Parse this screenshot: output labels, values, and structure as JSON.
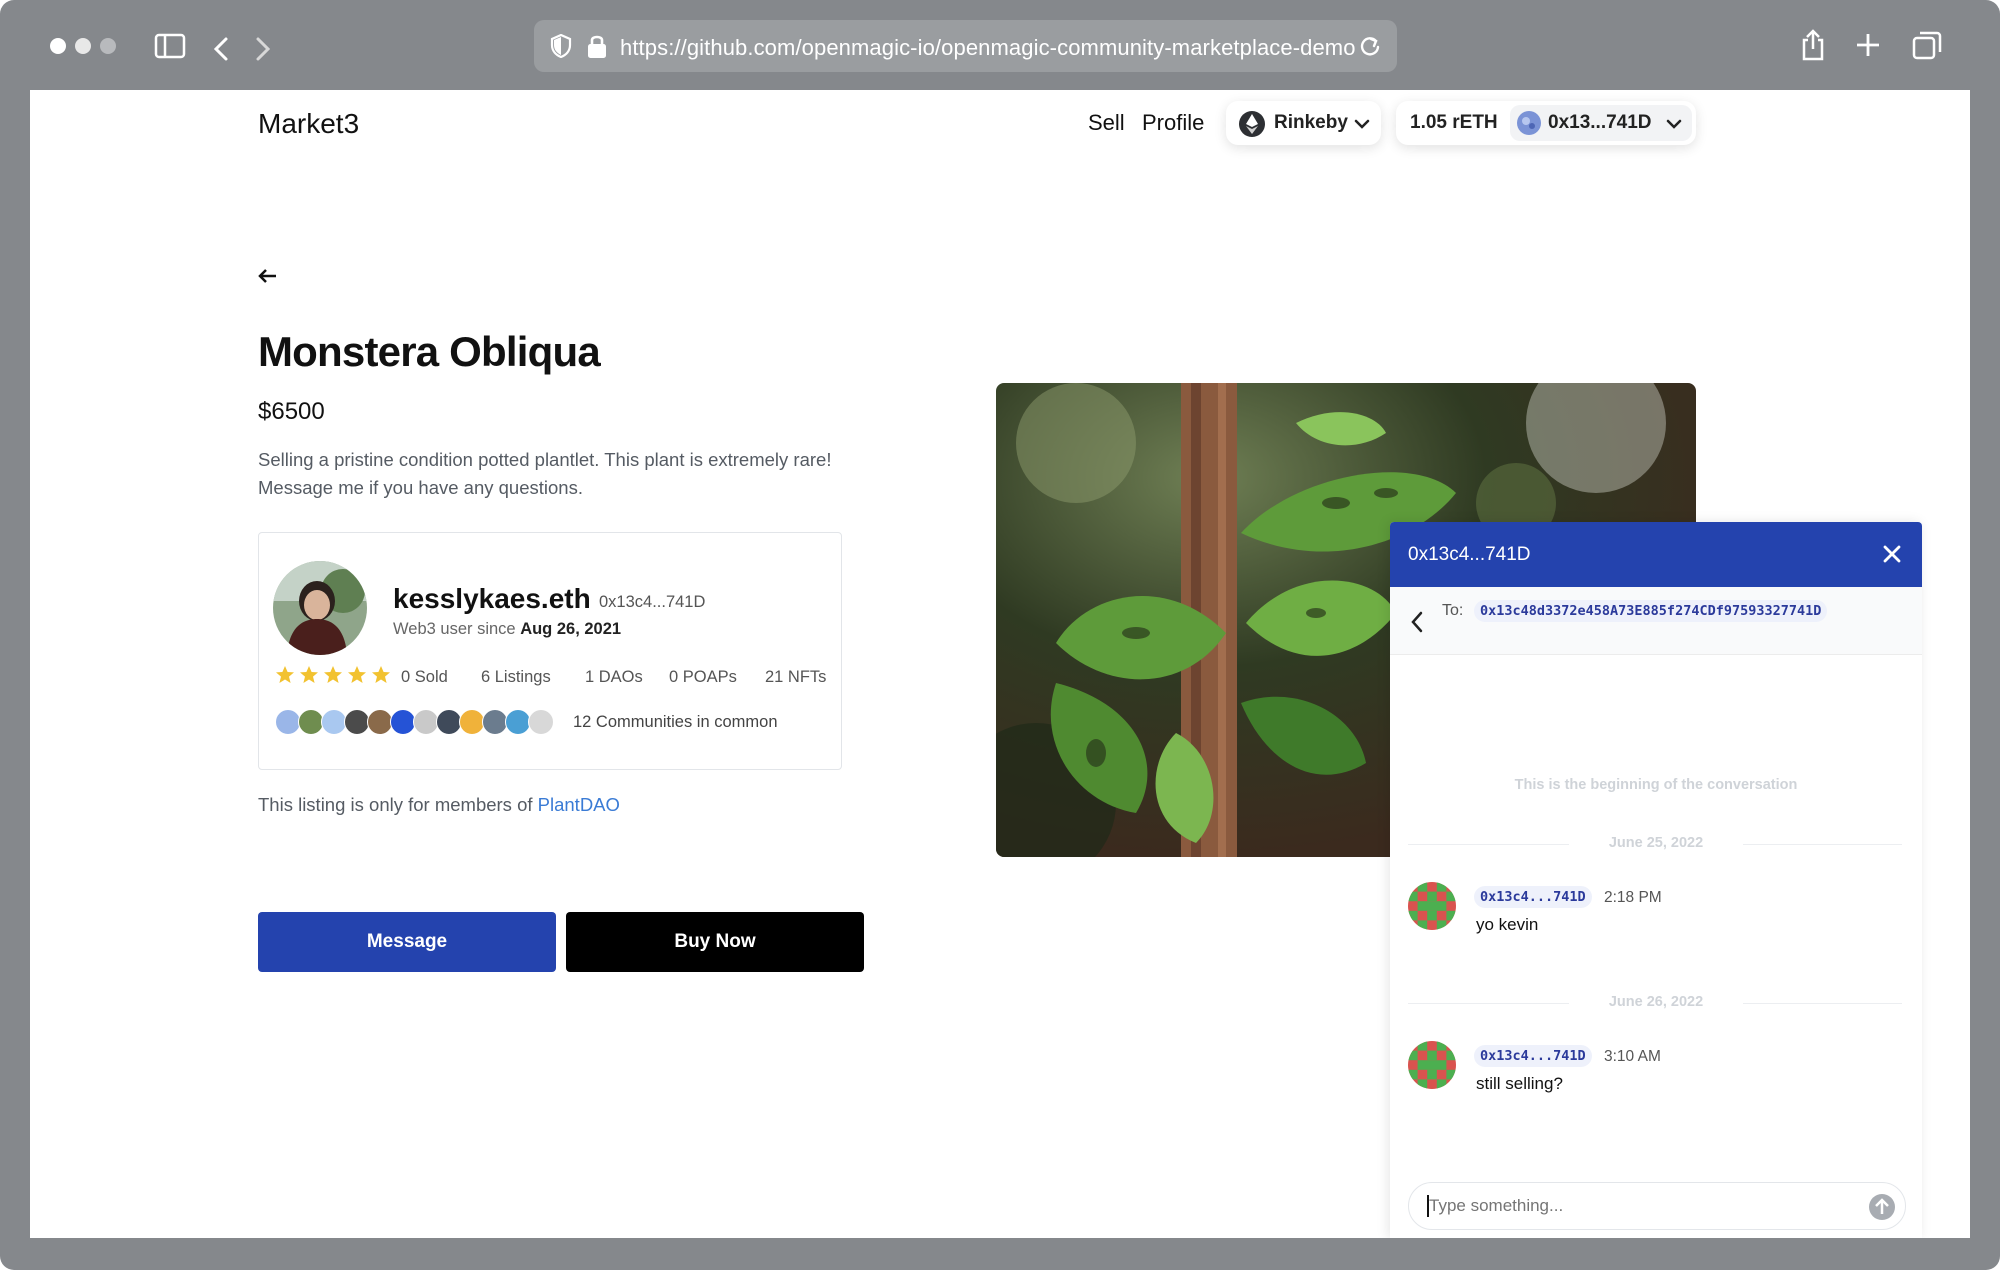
{
  "browser": {
    "url": "https://github.com/openmagic-io/openmagic-community-marketplace-demo"
  },
  "header": {
    "brand": "Market3",
    "nav": {
      "sell": "Sell",
      "profile": "Profile"
    },
    "network": "Rinkeby",
    "balance": "1.05 rETH",
    "account": "0x13...741D"
  },
  "listing": {
    "title": "Monstera Obliqua",
    "price": "$6500",
    "description": "Selling a pristine condition potted plantlet. This plant is extremely rare! Message me if you have any questions.",
    "members_prefix": "This listing is only for members of ",
    "members_link": "PlantDAO",
    "message_button": "Message",
    "buy_button": "Buy Now"
  },
  "seller": {
    "name": "kesslykaes.eth",
    "address": "0x13c4...741D",
    "since_prefix": "Web3 user since ",
    "since_date": "Aug 26, 2021",
    "rating": 5,
    "stats": {
      "sold": "0 Sold",
      "listings": "6 Listings",
      "daos": "1 DAOs",
      "poaps": "0 POAPs",
      "nfts": "21 NFTs"
    },
    "communities_text": "12 Communities in common",
    "community_colors": [
      "#9ab6e8",
      "#6f8d4f",
      "#a9c8f0",
      "#4b4b4b",
      "#8a6a4a",
      "#2553d6",
      "#c9c9c9",
      "#3f4a5a",
      "#f0b23a",
      "#6b7c8e",
      "#4a9fd4",
      "#d8d8d8"
    ]
  },
  "chat": {
    "title": "0x13c4...741D",
    "to_label": "To:",
    "to_address": "0x13c48d3372e458A73E885f274CDf97593327741D",
    "beginning": "This is the beginning of the conversation",
    "messages": [
      {
        "date": "June 25, 2022",
        "sender": "0x13c4...741D",
        "time": "2:18 PM",
        "text": "yo kevin"
      },
      {
        "date": "June 26, 2022",
        "sender": "0x13c4...741D",
        "time": "3:10 AM",
        "text": "still selling?"
      }
    ],
    "composer_placeholder": "Type something..."
  },
  "colors": {
    "primary": "#2443ae",
    "link": "#3a7bd5",
    "star": "#f2c230",
    "avatar_red": "#d9534f",
    "avatar_green": "#4caf50"
  }
}
